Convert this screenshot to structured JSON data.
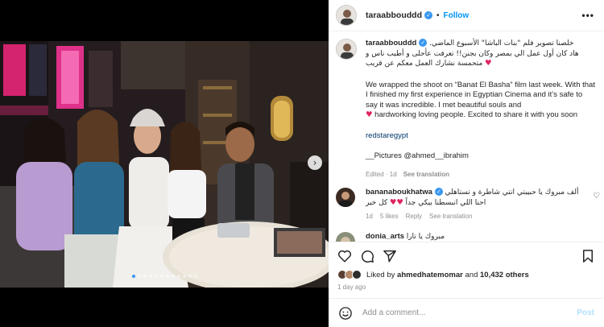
{
  "post": {
    "username": "taraabbouddd",
    "follow_label": "Follow",
    "more_label": "•••",
    "caption_arabic_line1": "خلصنا تصوير فلم \"بنات الباشا\" الأسبوع الماضي.",
    "caption_arabic_line2": "هاد كان أول عمل الي بمصر وكان بجنن!! تعرفت عأحلى و أطيب ناس و",
    "caption_arabic_line3": "متحمسة نشارك العمل معكم عن قريب",
    "caption_english": "We wrapped the shoot on “Banat El Basha” film last week. With that I finished my first experience in Egyptian Cinema and it’s safe to say it was incredible. I met beautiful souls and",
    "caption_english_2": "hardworking loving people. Excited to share it with you soon",
    "hashtag": "redstaregypt",
    "credit": "__Pictures @ahmed__ibrahim",
    "edited_label": "Edited · 1d",
    "see_translation": "See translation"
  },
  "comments": [
    {
      "username": "bananaboukhatwa",
      "text_line1": "ألف مبروك يا حبيبتي انتي شاطرة و تستاهلي",
      "text_line2": "كل خير",
      "text_line3": "احنا اللي انبسطنا بيكي جداً",
      "age": "1d",
      "likes": "5 likes",
      "reply": "Reply",
      "see_translation": "See translation"
    },
    {
      "username": "donia_arts",
      "text": "مبروك يا تارا"
    }
  ],
  "likes": {
    "prefix": "Liked by",
    "user": "ahmedhatemomar",
    "middle": "and",
    "count": "10,432 others"
  },
  "time_ago": "1 day ago",
  "add_comment": {
    "placeholder": "Add a comment...",
    "post_label": "Post"
  },
  "carousel": {
    "slides": 12,
    "active_index": 0
  },
  "colors": {
    "accent": "#0095f6",
    "verified": "#3897f0",
    "heart": "#e0245e",
    "muted": "#8e8e8e"
  },
  "icons": [
    "more-icon",
    "heart-icon",
    "comment-icon",
    "share-icon",
    "bookmark-icon",
    "emoji-icon",
    "verified-icon",
    "chevron-right-icon"
  ]
}
